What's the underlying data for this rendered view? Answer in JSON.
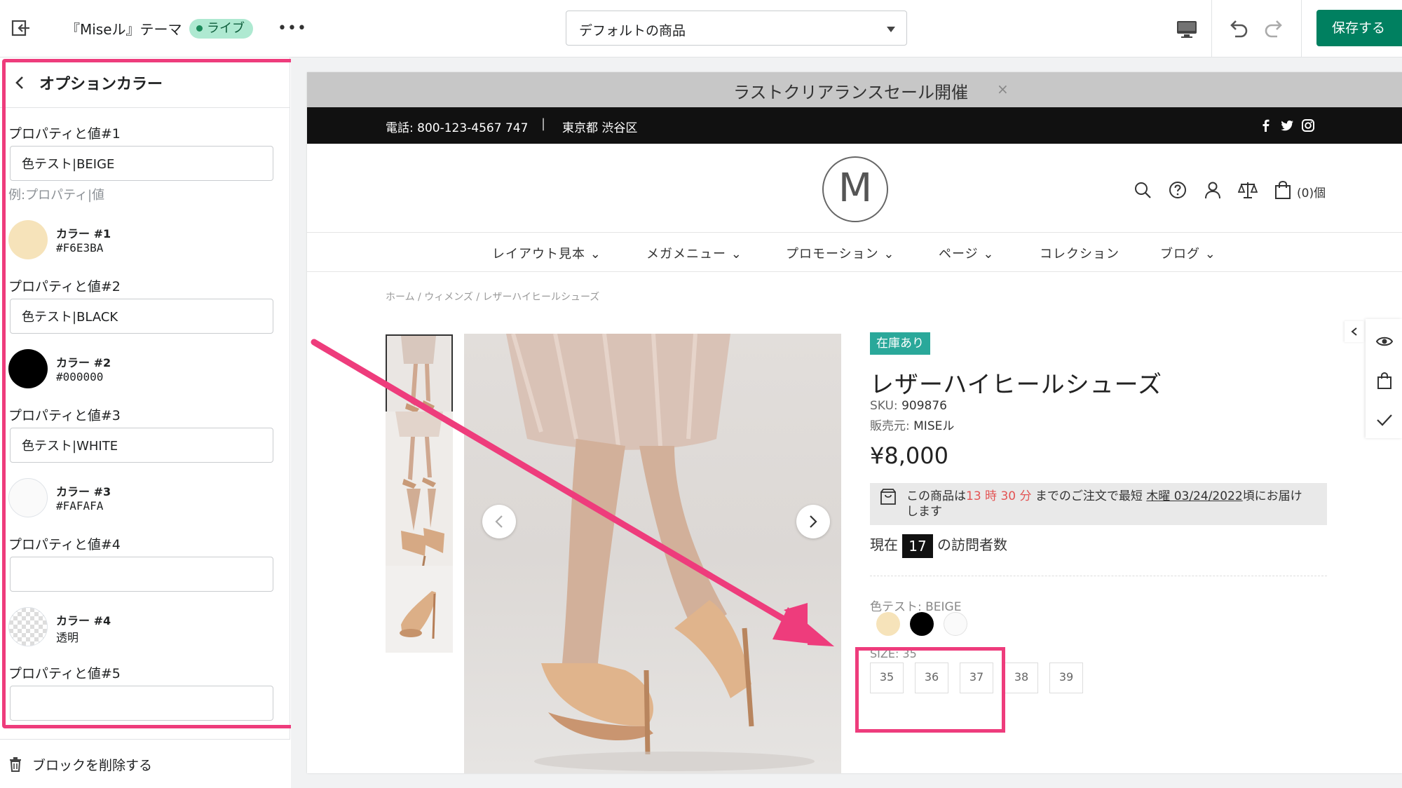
{
  "topbar": {
    "theme_name": "『Miseル』テーマ",
    "live_badge": "ライブ",
    "more_label": "•••",
    "page_selector_value": "デフォルトの商品",
    "save_label": "保存する"
  },
  "panel": {
    "title": "オプションカラー",
    "properties": [
      {
        "label": "プロパティと値#1",
        "value": "色テスト|BEIGE",
        "placeholder": ""
      },
      {
        "label": "プロパティと値#2",
        "value": "色テスト|BLACK",
        "placeholder": ""
      },
      {
        "label": "プロパティと値#3",
        "value": "色テスト|WHITE",
        "placeholder": ""
      },
      {
        "label": "プロパティと値#4",
        "value": "",
        "placeholder": ""
      },
      {
        "label": "プロパティと値#5",
        "value": "",
        "placeholder": ""
      }
    ],
    "hint": "例:プロパティ|値",
    "colors": [
      {
        "name": "カラー #1",
        "value": "#F6E3BA",
        "swatch": "#F6E3BA"
      },
      {
        "name": "カラー #2",
        "value": "#000000",
        "swatch": "#000000"
      },
      {
        "name": "カラー #3",
        "value": "#FAFAFA",
        "swatch": "#FAFAFA"
      },
      {
        "name": "カラー #4",
        "value": "透明",
        "swatch": "transparent"
      }
    ],
    "delete_label": "ブロックを削除する"
  },
  "store": {
    "announcement": "ラストクリアランスセール開催",
    "announcement_close": "×",
    "phone": "電話: 800-123-4567 747",
    "separator": "|",
    "location": "東京都 渋谷区",
    "logo_letter": "M",
    "cart_count": "(0)個",
    "nav": [
      "レイアウト見本 ⌄",
      "メガメニュー ⌄",
      "プロモーション ⌄",
      "ページ ⌄",
      "コレクション",
      "ブログ ⌄"
    ],
    "breadcrumb": "ホーム / ウィメンズ / レザーハイヒールシューズ"
  },
  "product": {
    "stock_badge": "在庫あり",
    "title": "レザーハイヒールシューズ",
    "sku_label": "SKU:",
    "sku": "909876",
    "vendor_label": "販売元:",
    "vendor": "MISEル",
    "price": "¥8,000",
    "delivery": {
      "pre": "この商品は",
      "hours": "13 時 30 分",
      "mid": " までのご注文で最短 ",
      "date": "木曜 03/24/2022",
      "post": "頃にお届けします"
    },
    "visitors_pre": "現在",
    "visitors_count": "17",
    "visitors_post": "の訪問者数",
    "variant_label": "色テスト: BEIGE",
    "variant_swatches": [
      "#F6E3BA",
      "#000000",
      "#FAFAFA"
    ],
    "size_label": "SIZE: 35",
    "sizes": [
      "35",
      "36",
      "37",
      "38",
      "39"
    ]
  },
  "colors": {
    "accent_pink": "#EE3C7C",
    "save_green": "#008060",
    "instock_teal": "#2AA89A"
  }
}
